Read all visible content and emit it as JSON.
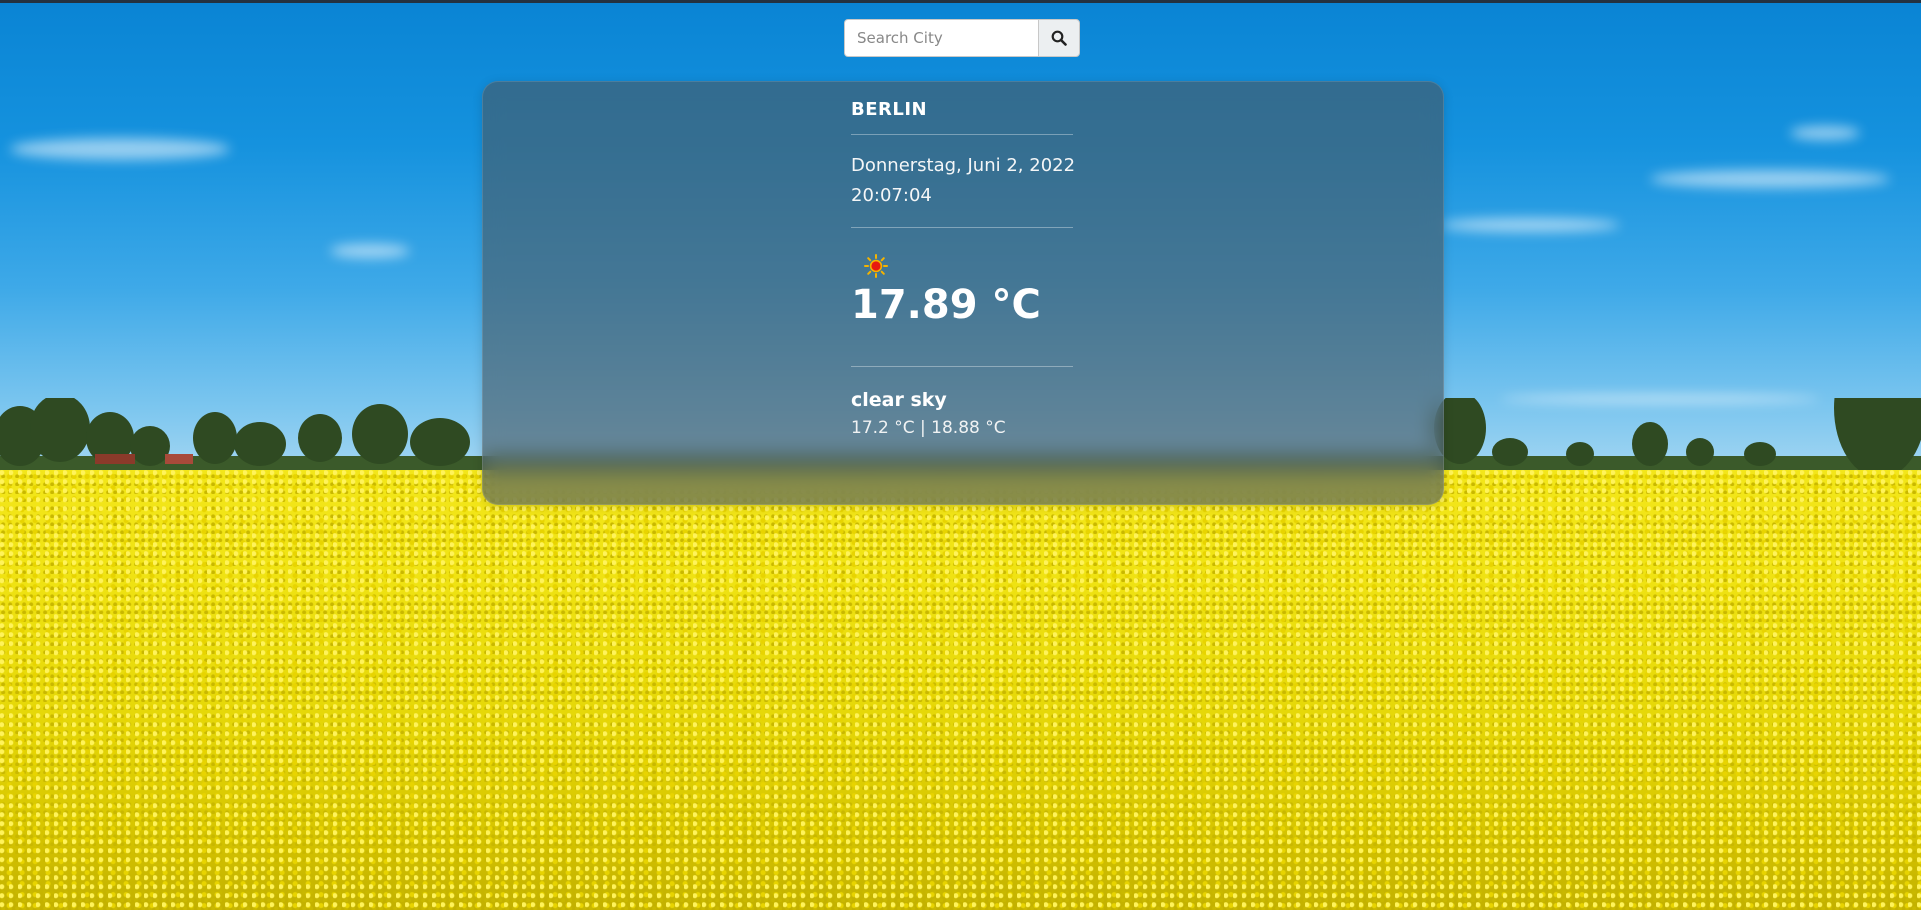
{
  "search": {
    "placeholder": "Search City",
    "value": "",
    "icon": "search-icon"
  },
  "weather": {
    "city": "BERLIN",
    "date": "Donnerstag, Juni 2, 2022",
    "time": "20:07:04",
    "icon": "sun-icon",
    "temperature": "17.89 °C",
    "description": "clear sky",
    "range": "17.2 °C | 18.88 °C"
  },
  "colors": {
    "card_overlay": "#485862",
    "text": "#ffffff",
    "sun_core": "#e8190f",
    "sun_rays": "#f5b400"
  }
}
